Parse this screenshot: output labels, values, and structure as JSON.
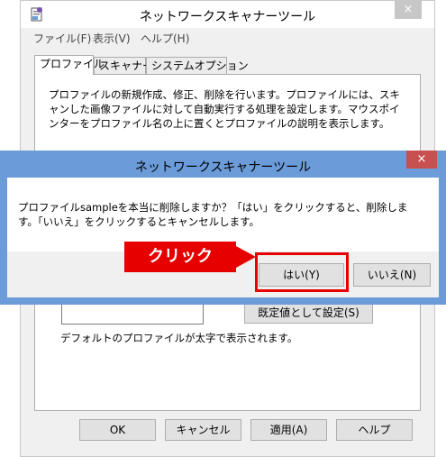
{
  "main_window": {
    "title": "ネットワークスキャナーツール",
    "close_label": "×",
    "menu": [
      {
        "label": "ファイル(F)"
      },
      {
        "label": "表示(V)"
      },
      {
        "label": "ヘルプ(H)"
      }
    ],
    "tabs": [
      {
        "label": "プロファイル"
      },
      {
        "label": "スキャナー"
      },
      {
        "label": "システムオプション"
      }
    ],
    "panel": {
      "description": "プロファイルの新規作成、修正、削除を行います。プロファイルには、スキャンした画像ファイルに対して自動実行する処理を設定します。マウスポインターをプロファイル名の上に置くとプロファイルの説明を表示します。",
      "default_button": "既定値として設定(S)",
      "note": "デフォルトのプロファイルが太字で表示されます。"
    },
    "buttons": {
      "ok": "OK",
      "cancel": "キャンセル",
      "apply": "適用(A)",
      "help": "ヘルプ"
    }
  },
  "dialog": {
    "title": "ネットワークスキャナーツール",
    "close_label": "×",
    "message": "プロファイルsampleを本当に削除しますか？「はい」をクリックすると、削除します。「いいえ」をクリックするとキャンセルします。",
    "yes_label": "はい(Y)",
    "no_label": "いいえ(N)"
  },
  "annotation": {
    "callout_text": "クリック",
    "color": "#e60000"
  },
  "colors": {
    "dialog_frame": "#6b9bd8",
    "dialog_close": "#c75050",
    "window_bg": "#f0f0f0"
  },
  "icons": {
    "app": "scanner-app-icon"
  }
}
